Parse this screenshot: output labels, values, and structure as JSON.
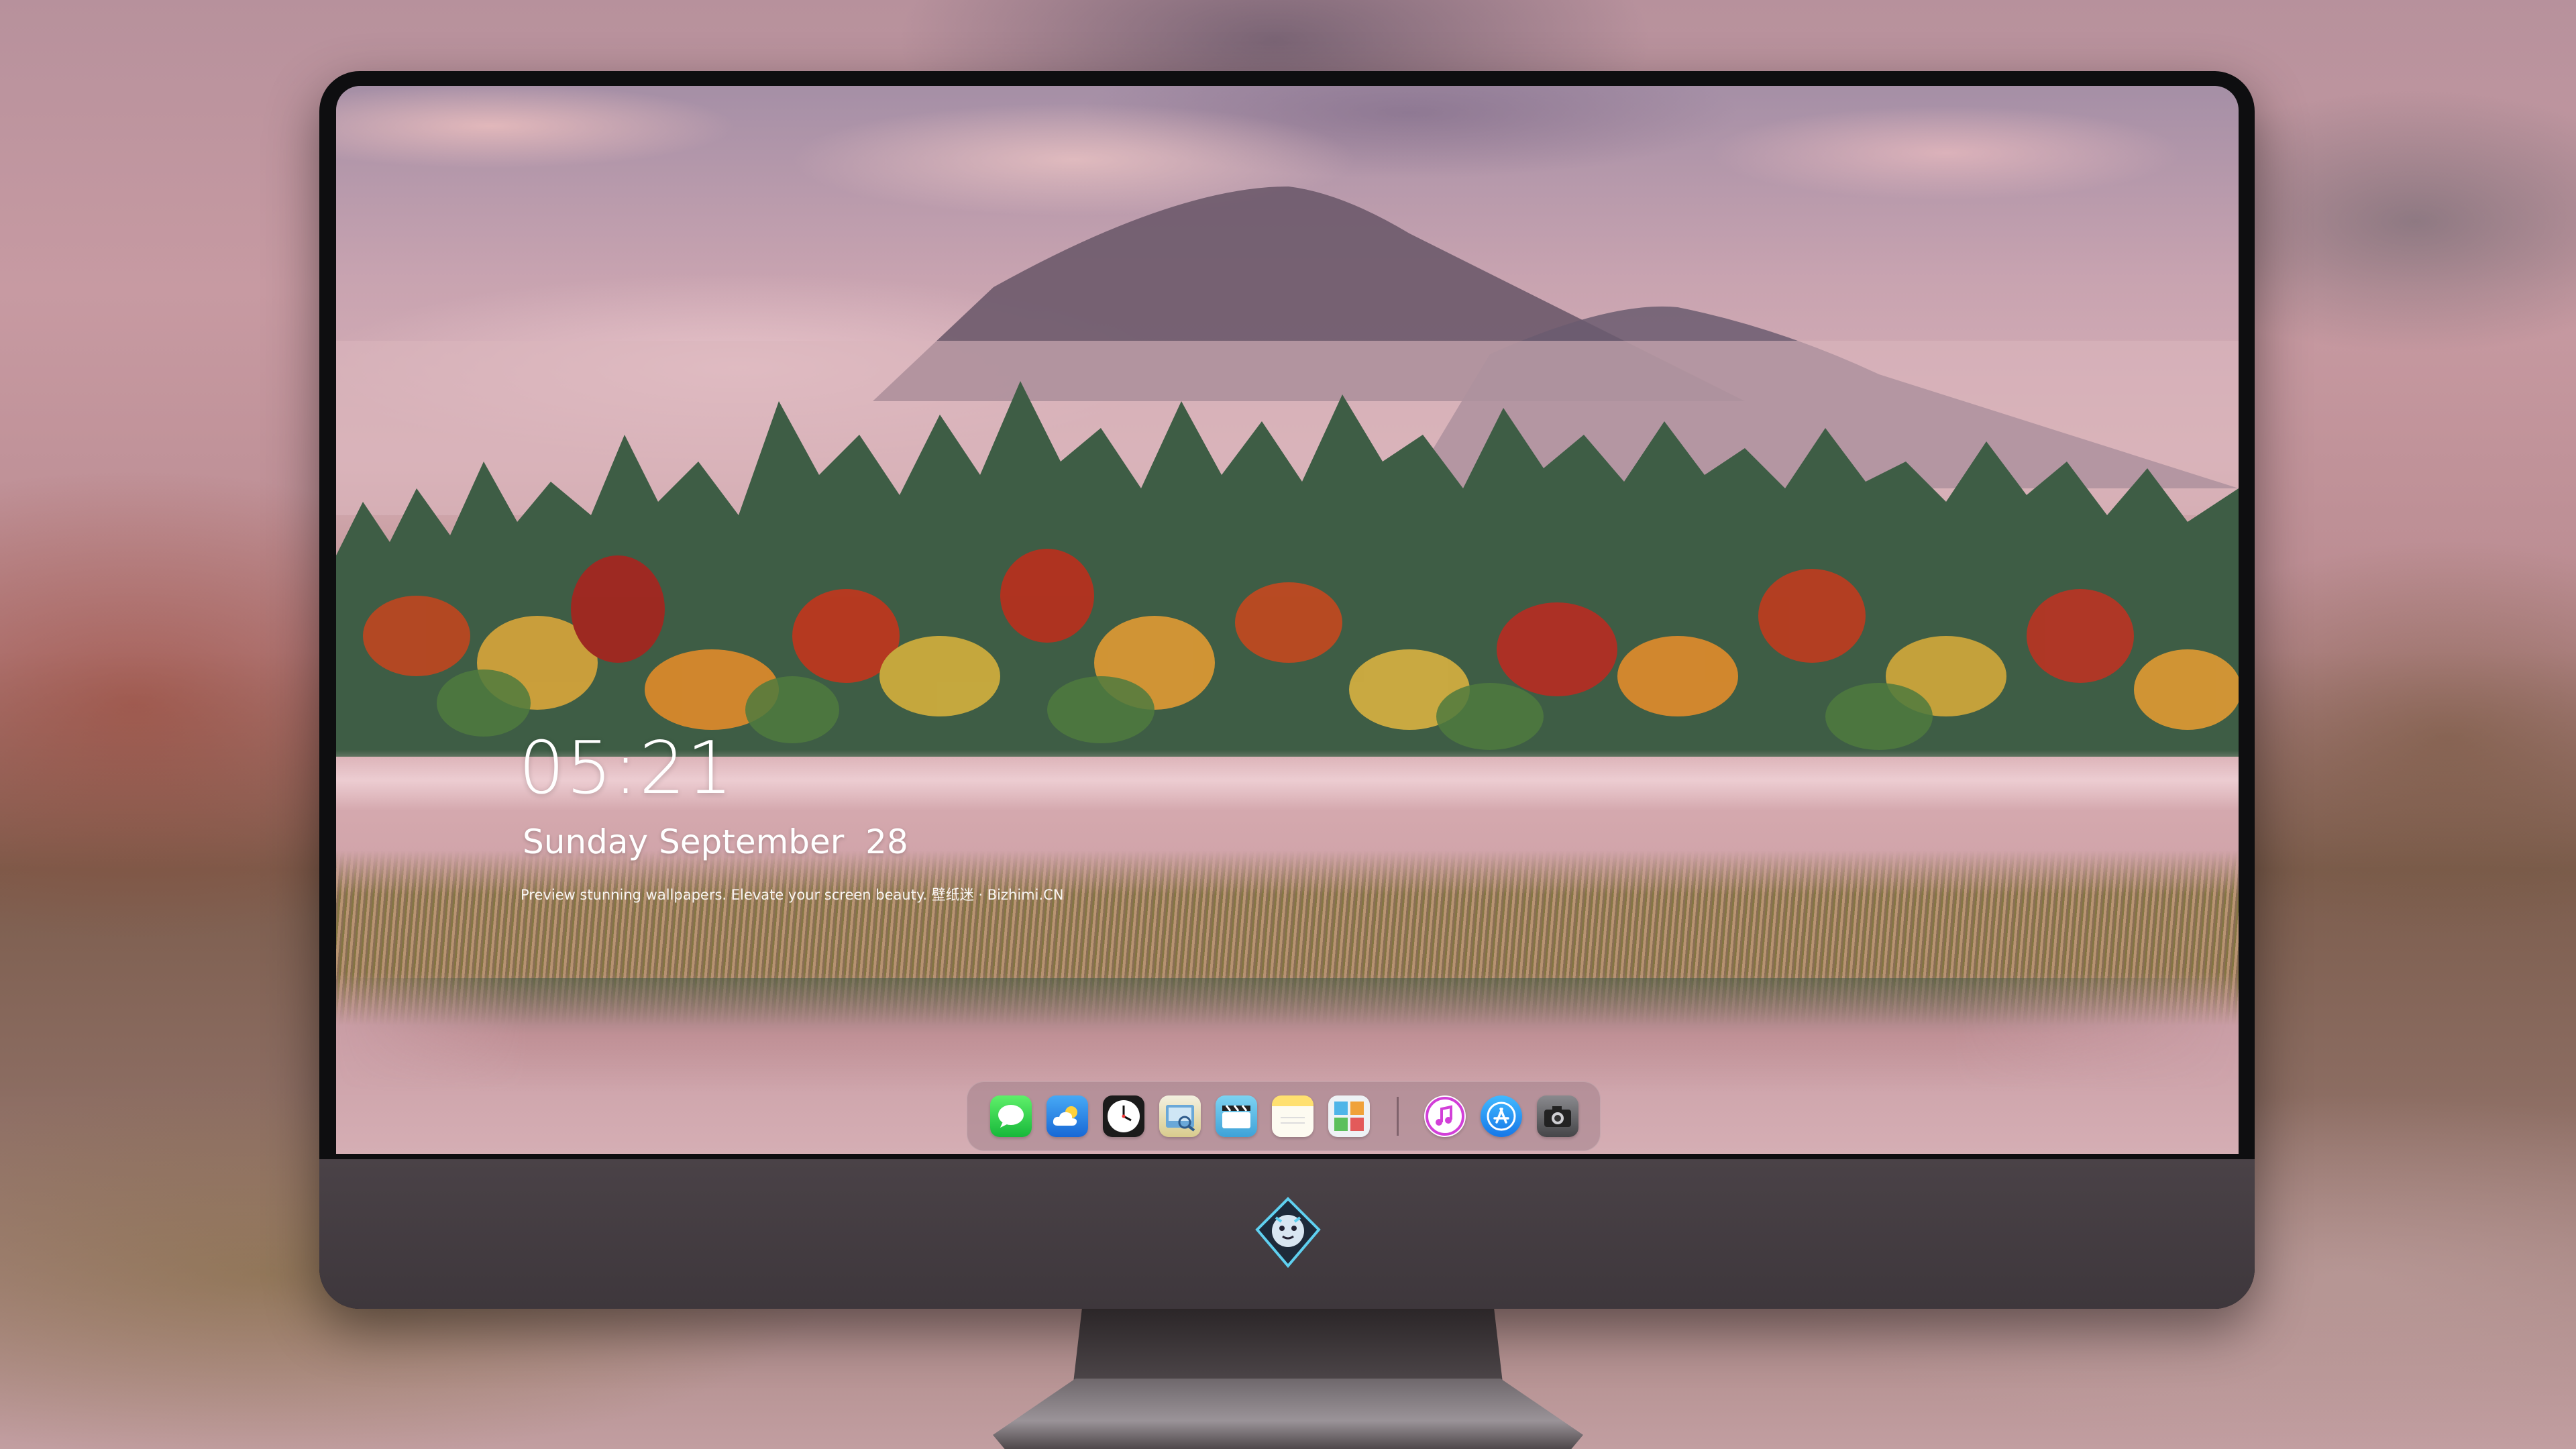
{
  "lock_screen": {
    "time": "05:21",
    "date": "Sunday September  28",
    "caption": "Preview stunning wallpapers. Elevate your screen beauty. 壁纸迷 · Bizhimi.CN"
  },
  "dock": {
    "apps": [
      {
        "name": "messages-icon",
        "color": "#2fcf4f"
      },
      {
        "name": "weather-icon",
        "color": "#2a8be8"
      },
      {
        "name": "clock-icon",
        "color": "#1b1b1b"
      },
      {
        "name": "preview-icon",
        "color": "#e8d57a"
      },
      {
        "name": "clips-icon",
        "color": "#56b6e8"
      },
      {
        "name": "notes-icon",
        "color": "#f7d25c"
      },
      {
        "name": "photos-collage-icon",
        "color": "#7a8f9f"
      },
      {
        "name": "music-icon",
        "color": "#d23fd8"
      },
      {
        "name": "app-store-icon",
        "color": "#1b8df2"
      },
      {
        "name": "camera-icon",
        "color": "#5c5c60"
      }
    ]
  }
}
